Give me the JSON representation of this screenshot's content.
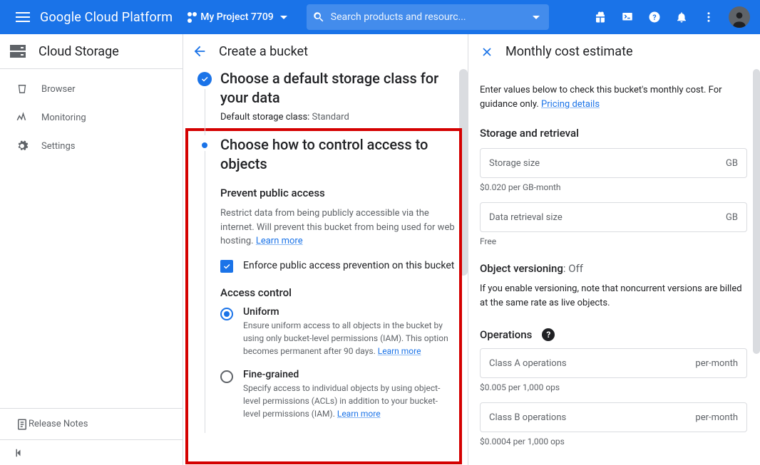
{
  "topbar": {
    "brand": "Google Cloud Platform",
    "project": "My Project 7709",
    "search_placeholder": "Search products and resourc..."
  },
  "sidebar": {
    "product": "Cloud Storage",
    "items": [
      {
        "label": "Browser"
      },
      {
        "label": "Monitoring"
      },
      {
        "label": "Settings"
      }
    ],
    "release_notes": "Release Notes"
  },
  "mid": {
    "title": "Create a bucket",
    "step_done": {
      "title": "Choose a default storage class for your data",
      "sub_key": "Default storage class:",
      "sub_val": " Standard"
    },
    "step_current": {
      "title": "Choose how to control access to objects",
      "prevent_h": "Prevent public access",
      "prevent_p": "Restrict data from being publicly accessible via the internet. Will prevent this bucket from being used for web hosting. ",
      "learn": "Learn more",
      "checkbox": "Enforce public access prevention on this bucket",
      "access_h": "Access control",
      "uniform_l": "Uniform",
      "uniform_d1": "Ensure uniform access to all objects in the bucket by using only bucket-level permissions (IAM). This option becomes permanent after 90 days. ",
      "fine_l": "Fine-grained",
      "fine_d1": "Specify access to individual objects by using object-level permissions (ACLs) in addition to your bucket-level permissions (IAM). "
    }
  },
  "right": {
    "title": "Monthly cost estimate",
    "intro1": "Enter values below to check this bucket's monthly cost. For guidance only. ",
    "pricing": "Pricing details",
    "storage_h": "Storage and retrieval",
    "storage_size": "Storage size",
    "gb": "GB",
    "storage_hint": "$0.020 per GB-month",
    "retrieval": "Data retrieval size",
    "free": "Free",
    "versioning_lead": "Object versioning",
    "versioning_val": ": Off",
    "versioning_desc": "If you enable versioning, note that noncurrent versions are billed at the same rate as live objects.",
    "ops_h": "Operations",
    "classA": "Class A operations",
    "per_month": "per-month",
    "classA_hint": "$0.005 per 1,000 ops",
    "classB": "Class B operations",
    "classB_hint": "$0.0004 per 1,000 ops"
  }
}
